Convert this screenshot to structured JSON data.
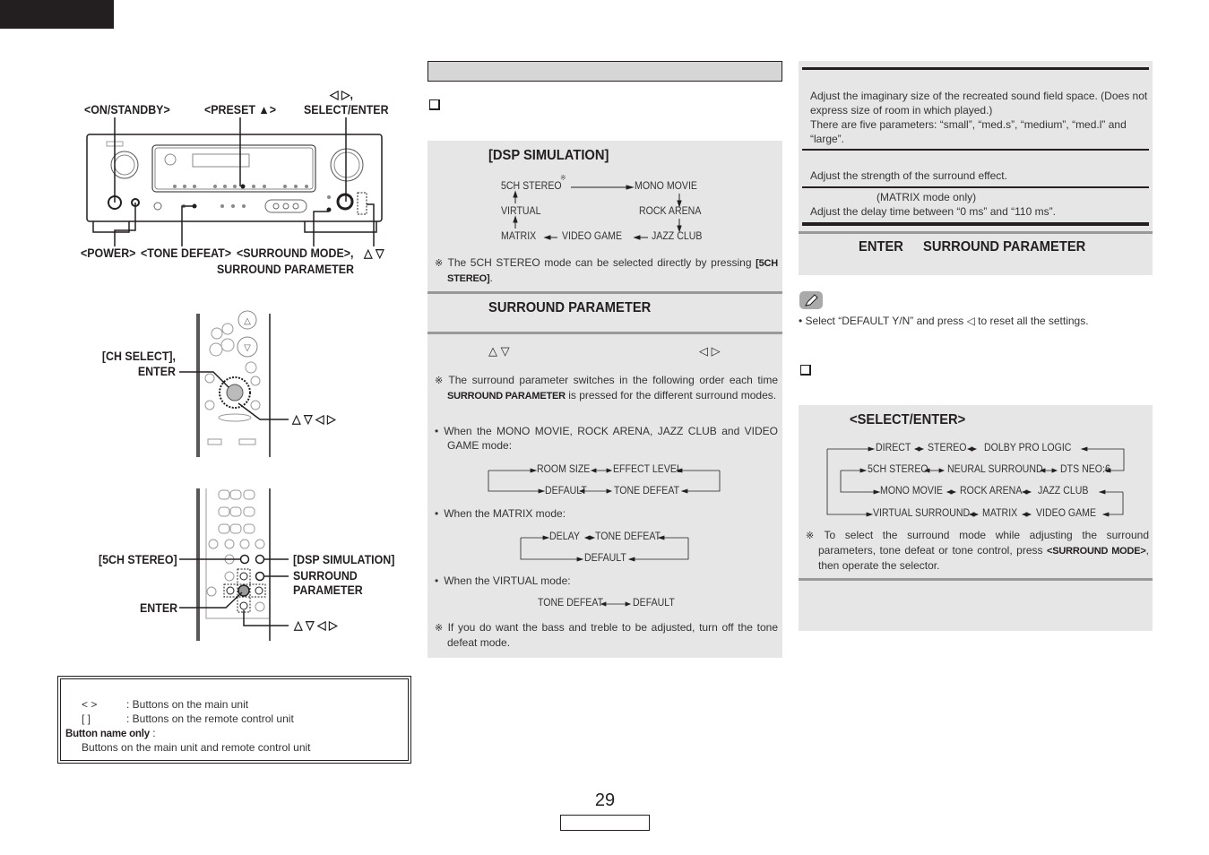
{
  "page": {
    "number": "29"
  },
  "left": {
    "main_unit_labels": {
      "on_standby": "<ON/STANDBY>",
      "preset": "<PRESET ▲>",
      "select_arrows": "◁ ▷,",
      "select_enter": "SELECT/ENTER",
      "power": "<POWER>",
      "tone_defeat": "<TONE DEFEAT>",
      "surround_mode": "<SURROUND MODE>,",
      "surround_parameter": "SURROUND PARAMETER",
      "up_down": "△ ▽"
    },
    "remote1_labels": {
      "ch_select": "[CH SELECT],",
      "enter": "ENTER",
      "arrows": "△ ▽ ◁ ▷"
    },
    "remote2_labels": {
      "five_ch_stereo": "[5CH STEREO]",
      "dsp_simulation": "[DSP SIMULATION]",
      "surround": "SURROUND",
      "parameter": "PARAMETER",
      "enter": "ENTER",
      "arrows": "△ ▽ ◁ ▷"
    },
    "legend": {
      "rows": [
        {
          "symbol": "<     >",
          "desc": ": Buttons on the main unit"
        },
        {
          "symbol": "[      ]",
          "desc": ": Buttons on the remote control unit"
        }
      ],
      "bold_label": "Button name only",
      "bold_suffix": " :",
      "last_line": "Buttons on the main unit and remote control unit"
    }
  },
  "middle": {
    "dsp_title": "[DSP SIMULATION]",
    "dsp_flow": {
      "five_ch": "5CH STEREO",
      "mono_movie": "MONO MOVIE",
      "virtual": "VIRTUAL",
      "rock_arena": "ROCK ARENA",
      "matrix": "MATRIX",
      "video_game": "VIDEO GAME",
      "jazz_club": "JAZZ CLUB",
      "note_mark": "※"
    },
    "dsp_note": "The 5CH STEREO mode can be selected directly by pressing ",
    "dsp_note_bold": "[5CH STEREO]",
    "dsp_note_end": ".",
    "surround_param_title": "SURROUND PARAMETER",
    "step_up_down": "△ ▽",
    "step_left_right": "◁ ▷",
    "note1_pre": "The surround parameter switches in the following order each time ",
    "note1_bold": "SURROUND PARAMETER",
    "note1_post": " is pressed for the different surround modes.",
    "bullet1": "When the MONO MOVIE, ROCK ARENA, JAZZ CLUB and VIDEO GAME mode:",
    "flow1": {
      "room_size": "ROOM SIZE",
      "effect_level": "EFFECT LEVEL",
      "default": "DEFAULT",
      "tone_defeat": "TONE DEFEAT"
    },
    "bullet2": "When the MATRIX mode:",
    "flow2": {
      "delay": "DELAY",
      "tone_defeat": "TONE DEFEAT",
      "default": "DEFAULT"
    },
    "bullet3": "When the VIRTUAL mode:",
    "flow3": {
      "tone_defeat": "TONE DEFEAT",
      "default": "DEFAULT"
    },
    "note2": "If you do want the bass and treble to be adjusted, turn off the tone defeat mode."
  },
  "right": {
    "room_size_desc1": "Adjust the imaginary size of the recreated sound field space. (Does not express size of room in which played.)",
    "room_size_desc2": "There are five parameters: “small”, “med.s”, “medium”, “med.l” and “large”.",
    "effect_level_desc": "Adjust the strength of the surround effect.",
    "delay_note": "(MATRIX mode only)",
    "delay_desc": "Adjust the delay time between “0 ms” and “110 ms”.",
    "enter_label": "ENTER",
    "surround_parameter_label": "SURROUND PARAMETER",
    "memo_bullet": "• Select “DEFAULT Y/N” and press ◁ to reset all the settings.",
    "select_enter_title": "<SELECT/ENTER>",
    "mode_flow": {
      "row1": [
        "DIRECT",
        "STEREO",
        "DOLBY PRO LOGIC"
      ],
      "row2": [
        "5CH STEREO",
        "NEURAL SURROUND",
        "DTS NEO:6"
      ],
      "row3": [
        "MONO MOVIE",
        "ROCK ARENA",
        "JAZZ CLUB"
      ],
      "row4": [
        "VIRTUAL SURROUND",
        "MATRIX",
        "VIDEO GAME"
      ]
    },
    "mode_note_pre": "To select the surround mode while adjusting the surround parameters, tone defeat or tone control, press ",
    "mode_note_bold": "<SURROUND MODE>",
    "mode_note_post": ", then operate the selector."
  },
  "icons": {
    "note_mark": "※",
    "memo": "pencil-icon"
  }
}
